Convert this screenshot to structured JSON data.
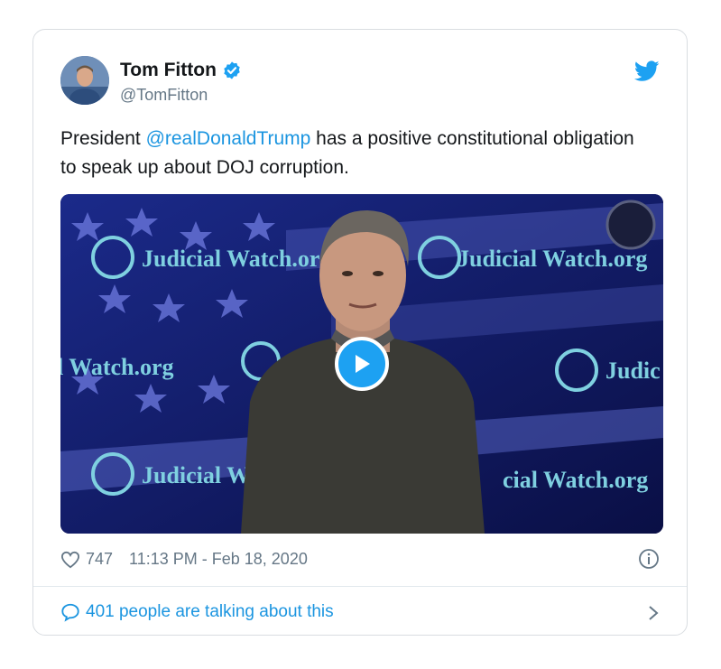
{
  "author": {
    "name": "Tom Fitton",
    "handle": "@TomFitton",
    "verified": true
  },
  "tweet": {
    "text_before": "President ",
    "mention": "@realDonaldTrump",
    "text_after": " has a positive constitutional obligation to speak up about DOJ corruption."
  },
  "media": {
    "type": "video",
    "backdrop_text": [
      "Judicial Watch.org",
      "Judicial Watch.org",
      "l Watch.org",
      "Judic",
      "Judicial W",
      "cial Watch.org"
    ],
    "icons": [
      "play-icon",
      "scales-of-justice-logo"
    ]
  },
  "meta": {
    "likes": "747",
    "timestamp": "11:13 PM - Feb 18, 2020"
  },
  "footer": {
    "talking": "401 people are talking about this"
  },
  "colors": {
    "accent": "#1da1f2",
    "link": "#1b95e0",
    "text": "#14171a",
    "muted": "#657786"
  }
}
